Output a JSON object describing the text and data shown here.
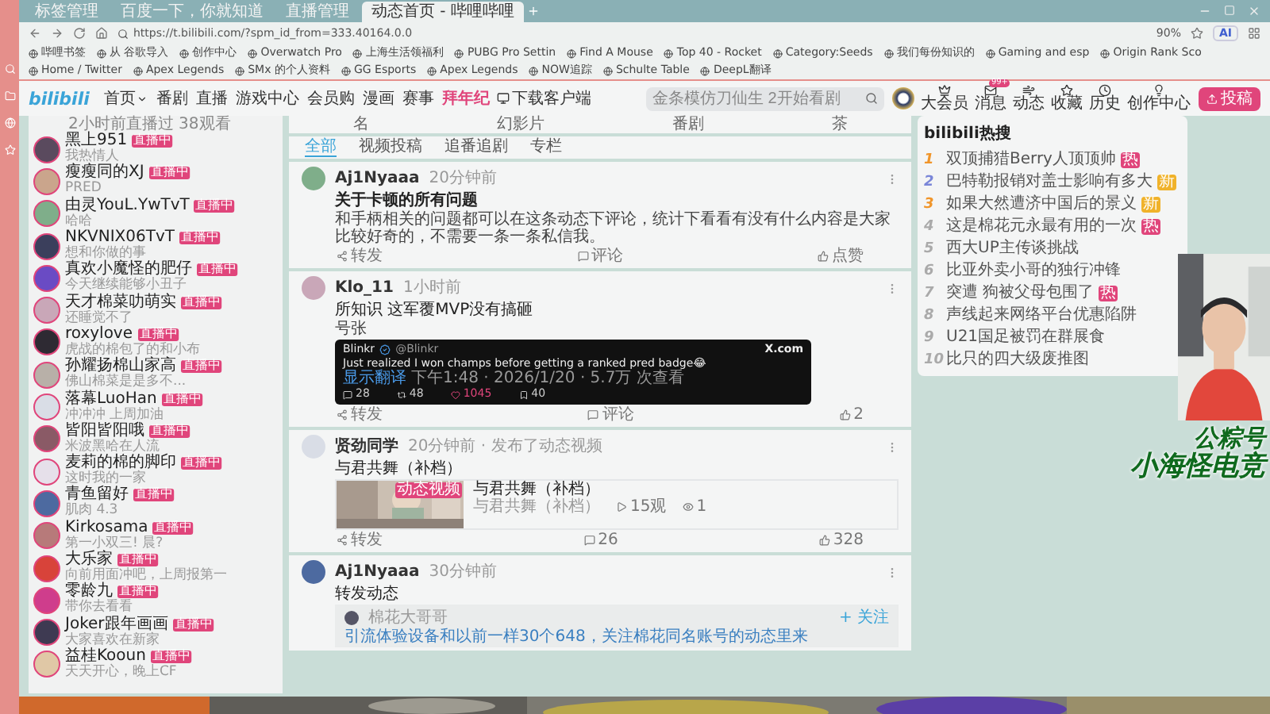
{
  "browser": {
    "tabs": [
      {
        "label": "标签管理",
        "selected": false
      },
      {
        "label": "百度一下，你就知道",
        "selected": false
      },
      {
        "label": "直播管理",
        "selected": false
      },
      {
        "label": "动态首页 - 哔哩哔哩",
        "selected": true
      }
    ],
    "address": "https://t.bilibili.com/?spm_id_from=333.40164.0.0",
    "zoom": "90%",
    "ai_button": "AI",
    "bookmarks": [
      "哔哩书签",
      "从 谷歌导入",
      "创作中心",
      "Overwatch Pro",
      "上海生活领福利",
      "PUBG Pro Settin",
      "Find A Mouse",
      "Top 40 - Rocket",
      "Category:Seeds",
      "我们每份知识的",
      "Gaming and esp",
      "Origin Rank Sco",
      "Home / Twitter",
      "Apex Legends",
      "SMx 的个人资料",
      "GG Esports",
      "Apex Legends",
      "NOW追踪",
      "Schulte Table",
      "DeepL翻译"
    ]
  },
  "site": {
    "logo": "bilibili",
    "nav": [
      {
        "label": "首页",
        "kind": "dropdown"
      },
      {
        "label": "番剧",
        "kind": "normal"
      },
      {
        "label": "直播",
        "kind": "normal"
      },
      {
        "label": "游戏中心",
        "kind": "normal"
      },
      {
        "label": "会员购",
        "kind": "normal"
      },
      {
        "label": "漫画",
        "kind": "normal"
      },
      {
        "label": "赛事",
        "kind": "normal"
      },
      {
        "label": "拜年纪",
        "kind": "highlight"
      },
      {
        "label": "下载客户端",
        "kind": "download"
      }
    ],
    "search": {
      "placeholder": "金条模仿刀仙生 2开始看剧"
    },
    "icons": [
      {
        "label": "大会员",
        "kind": "member"
      },
      {
        "label": "消息",
        "kind": "message",
        "badge": "99+"
      },
      {
        "label": "动态",
        "kind": "dynamic"
      },
      {
        "label": "收藏",
        "kind": "favorite"
      },
      {
        "label": "历史",
        "kind": "history"
      },
      {
        "label": "创作中心",
        "kind": "creator"
      }
    ],
    "upload_button": "投稿"
  },
  "following": {
    "top_fragment": "2小时前直播过 38观看",
    "items": [
      {
        "name": "黑上951",
        "status": "我热情人",
        "badge": "直播中"
      },
      {
        "name": "瘦瘦同的XJ",
        "status": "PRED",
        "badge": "直播中"
      },
      {
        "name": "由灵YouL.YwTvT",
        "status": "哈哈",
        "badge": "直播中"
      },
      {
        "name": "NKVNIX06TvT",
        "status": "想和你做的事",
        "badge": "直播中"
      },
      {
        "name": "真欢小魔怪的肥仔",
        "status": "今天继续能够小丑子",
        "badge": "直播中"
      },
      {
        "name": "天才棉菜叻萌实",
        "status": "还睡觉不了",
        "badge": "直播中"
      },
      {
        "name": "roxylove",
        "status": "虎战的棉包了的和小布",
        "badge": "直播中"
      },
      {
        "name": "孙耀扬棉山家高",
        "status": "佛山棉菜是是多不...",
        "badge": "直播中"
      },
      {
        "name": "落幕LuoHan",
        "status": "冲冲冲 上周加油",
        "badge": "直播中"
      },
      {
        "name": "皆阳皆阳哦",
        "status": "米波黑哈在人流",
        "badge": "直播中"
      },
      {
        "name": "麦莉的棉的脚印",
        "status": "这时我的一家",
        "badge": "直播中"
      },
      {
        "name": "青鱼留好",
        "status": "肌肉 4.3",
        "badge": "直播中"
      },
      {
        "name": "Kirkosama",
        "status": "第一小双三! 晨?",
        "badge": "直播中"
      },
      {
        "name": "大乐家",
        "status": "向前用面冲吧，上周报第一",
        "badge": "直播中"
      },
      {
        "name": "零龄九",
        "status": "带你去看看",
        "badge": "直播中"
      },
      {
        "name": "Joker跟年画画",
        "status": "大家喜欢在新家",
        "badge": "直播中"
      },
      {
        "name": "益桂Kooun",
        "status": "天天开心，晚上CF",
        "badge": "直播中"
      }
    ]
  },
  "feed": {
    "top_strip": [
      "名",
      "幻影片",
      "番剧",
      "茶"
    ],
    "tabs": [
      {
        "label": "全部",
        "selected": true
      },
      {
        "label": "视频投稿",
        "selected": false
      },
      {
        "label": "追番追剧",
        "selected": false
      },
      {
        "label": "专栏",
        "selected": false
      }
    ],
    "posts": [
      {
        "kind": "text",
        "author": "Aj1Nyaaa",
        "time": "20分钟前",
        "title": "关于卡顿的所有问题",
        "body": "和手柄相关的问题都可以在这条动态下评论，统计下看看有没有什么内容是大家比较好奇的，不需要一条一条私信我。",
        "actions": [
          "转发",
          "评论",
          "点赞"
        ]
      },
      {
        "kind": "tweet",
        "author": "Klo_11",
        "time": "1小时前",
        "title": "所知识 这军覆MVP没有搞砸",
        "body": "号张",
        "tweet": {
          "name": "Blinkr",
          "handle": "@Blinkr",
          "site": "X.com",
          "text": "Just realized I won champs before getting a ranked pred badge😂",
          "translate": "显示翻译",
          "meta": "下午1:48 · 2026/1/20 · 5.7万 次查看",
          "stats": [
            "28",
            "48",
            "1045",
            "40"
          ]
        },
        "actions": [
          "转发",
          "评论",
          "2"
        ]
      },
      {
        "kind": "video",
        "author": "贤劲同学",
        "time": "20分钟前 · 发布了动态视频",
        "title": "与君共舞（补档）",
        "video": {
          "badge": "动态视频",
          "title": "与君共舞（补档）",
          "subtitle": "与君共舞（补档）",
          "stats": [
            "15观",
            "1"
          ]
        },
        "actions": [
          "转发",
          "26",
          "328"
        ]
      },
      {
        "kind": "repost",
        "author": "Aj1Nyaaa",
        "time": "30分钟前",
        "title": "转发动态",
        "quote": {
          "author": "棉花大哥哥",
          "follow": "+ 关注",
          "text": "引流体验设备和以前一样30个648，关注棉花同名账号的动态里来"
        }
      }
    ]
  },
  "hot": {
    "title": "bilibili热搜",
    "items": [
      {
        "rank": "1",
        "color": "#f0952a",
        "text": "双顶捕猎Berry人顶顶帅",
        "badge": {
          "text": "热",
          "color": "#e0457b"
        }
      },
      {
        "rank": "2",
        "color": "#7a86d8",
        "text": "巴特勒报销对盖士影响有多大",
        "badge": {
          "text": "新",
          "color": "#f0b22a"
        }
      },
      {
        "rank": "3",
        "color": "#f0952a",
        "text": "如果大然遭济中国后的景义",
        "badge": {
          "text": "新",
          "color": "#f0b22a"
        }
      },
      {
        "rank": "4",
        "color": "#aaaaaa",
        "text": "这是棉花元永最有用的一次",
        "badge": {
          "text": "热",
          "color": "#e0457b"
        }
      },
      {
        "rank": "5",
        "color": "#aaaaaa",
        "text": "西大UP主传谈挑战"
      },
      {
        "rank": "6",
        "color": "#aaaaaa",
        "text": "比亚外卖小哥的独行冲锋"
      },
      {
        "rank": "7",
        "color": "#aaaaaa",
        "text": "突遭 狗被父母包围了",
        "badge": {
          "text": "热",
          "color": "#e0457b"
        }
      },
      {
        "rank": "8",
        "color": "#aaaaaa",
        "text": "声线起来网络平台优惠陷阱"
      },
      {
        "rank": "9",
        "color": "#aaaaaa",
        "text": "U21国足被罚在群展食"
      },
      {
        "rank": "10",
        "color": "#aaaaaa",
        "text": "比只的四大级废推图"
      }
    ]
  },
  "overlay": {
    "lines": [
      "公粽号",
      "小海怪电竞"
    ]
  }
}
